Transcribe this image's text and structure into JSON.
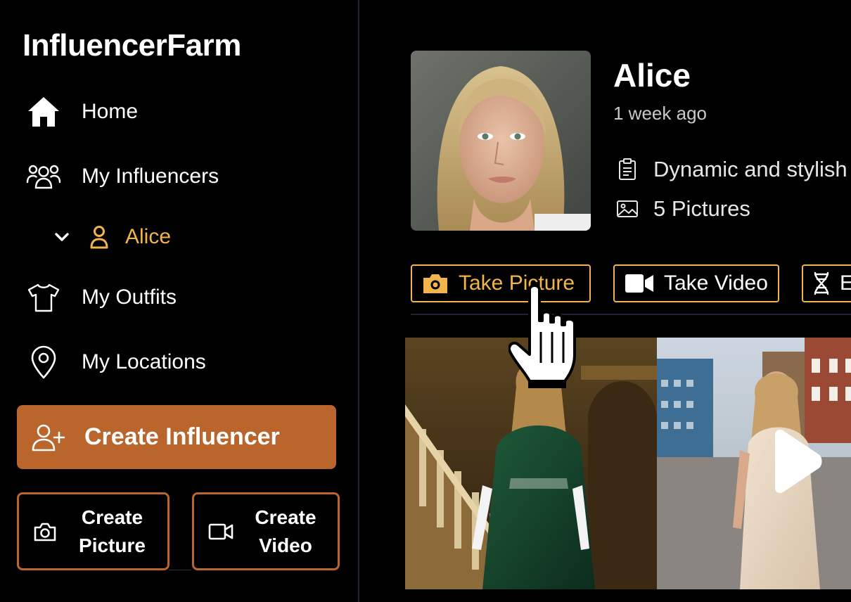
{
  "brand": "InfluencerFarm",
  "nav": {
    "home": "Home",
    "my_influencers": "My Influencers",
    "sub_item": "Alice",
    "my_outfits": "My Outfits",
    "my_locations": "My Locations"
  },
  "actions": {
    "create_influencer": "Create Influencer",
    "create_picture": "Create\nPicture",
    "create_video": "Create\nVideo"
  },
  "profile": {
    "name": "Alice",
    "time_ago": "1 week ago",
    "description": "Dynamic and stylish",
    "pictures": "5 Pictures"
  },
  "toolbar": {
    "take_picture": "Take Picture",
    "take_video": "Take Video",
    "third_label": "E"
  },
  "colors": {
    "accent": "#f2b44b",
    "brand_button": "#b9652b",
    "background": "#000000"
  },
  "icons": {
    "home": "home-icon",
    "influencers": "users-icon",
    "sub": "user-icon",
    "outfits": "shirt-icon",
    "locations": "map-pin-icon",
    "create_influencer": "user-plus-icon",
    "camera": "camera-icon",
    "video": "video-icon",
    "description": "clipboard-icon",
    "pictures": "image-icon",
    "third_action": "dna-icon",
    "play": "play-icon"
  }
}
